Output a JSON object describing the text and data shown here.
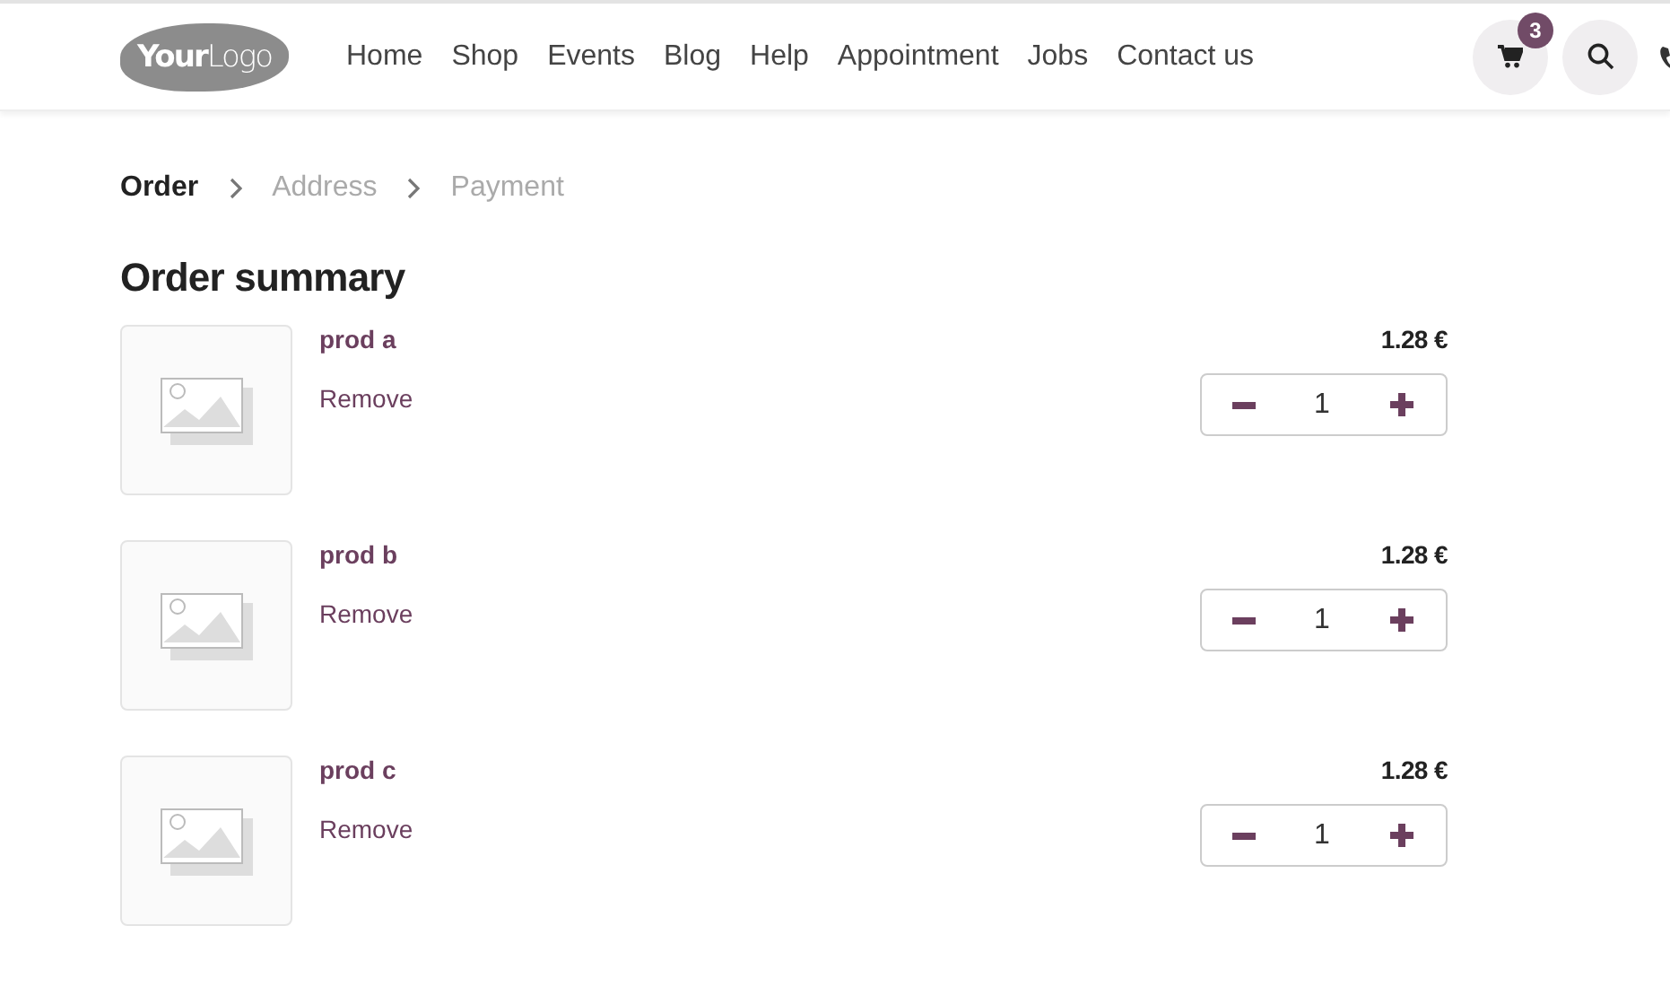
{
  "logo": {
    "bold": "Your",
    "light": "Logo"
  },
  "nav": [
    {
      "label": "Home"
    },
    {
      "label": "Shop"
    },
    {
      "label": "Events"
    },
    {
      "label": "Blog"
    },
    {
      "label": "Help"
    },
    {
      "label": "Appointment"
    },
    {
      "label": "Jobs"
    },
    {
      "label": "Contact us"
    }
  ],
  "cart": {
    "count": "3"
  },
  "breadcrumb": [
    {
      "label": "Order",
      "selected": true
    },
    {
      "label": "Address",
      "selected": false
    },
    {
      "label": "Payment",
      "selected": false
    }
  ],
  "heading": "Order summary",
  "items": [
    {
      "name": "prod a",
      "remove": "Remove",
      "price": "1.28 €",
      "quantity": "1"
    },
    {
      "name": "prod b",
      "remove": "Remove",
      "price": "1.28 €",
      "quantity": "1"
    },
    {
      "name": "prod c",
      "remove": "Remove",
      "price": "1.28 €",
      "quantity": "1"
    }
  ]
}
